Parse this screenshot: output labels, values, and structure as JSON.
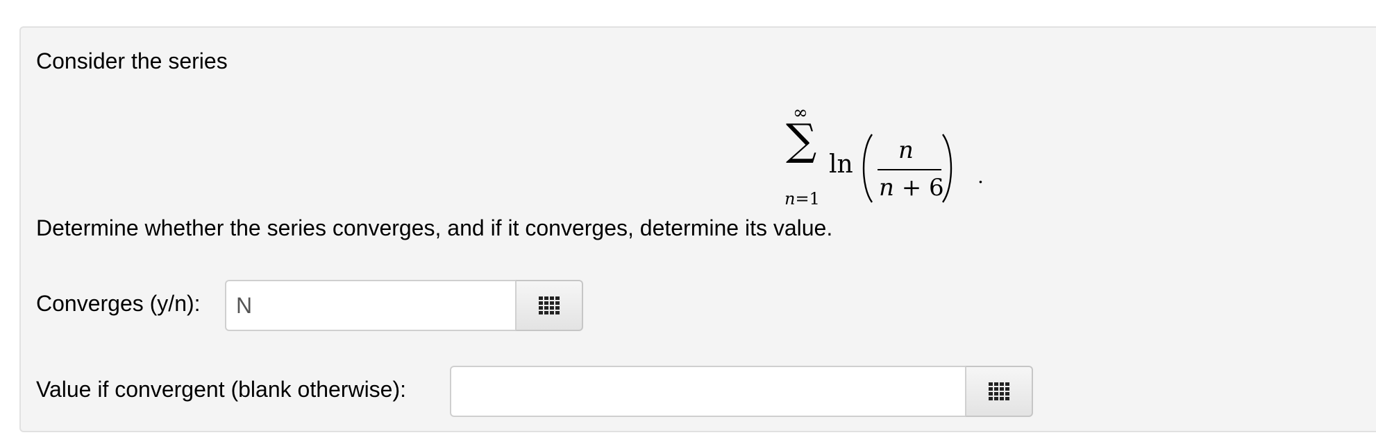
{
  "problem": {
    "intro": "Consider the series",
    "math": {
      "upper_limit": "∞",
      "sum_symbol": "∑",
      "lower_var": "n",
      "lower_eq": "=",
      "lower_value": "1",
      "function": "ln",
      "numerator": "n",
      "denominator_var": "n",
      "denominator_op": "+",
      "denominator_value": "6",
      "terminal_punctuation": "."
    },
    "question": "Determine whether the series converges, and if it converges, determine its value."
  },
  "converges": {
    "label": "Converges (y/n):",
    "value": "N",
    "palette_icon": "grid-icon"
  },
  "value_field": {
    "label": "Value if convergent (blank otherwise):",
    "value": "",
    "palette_icon": "grid-icon"
  }
}
